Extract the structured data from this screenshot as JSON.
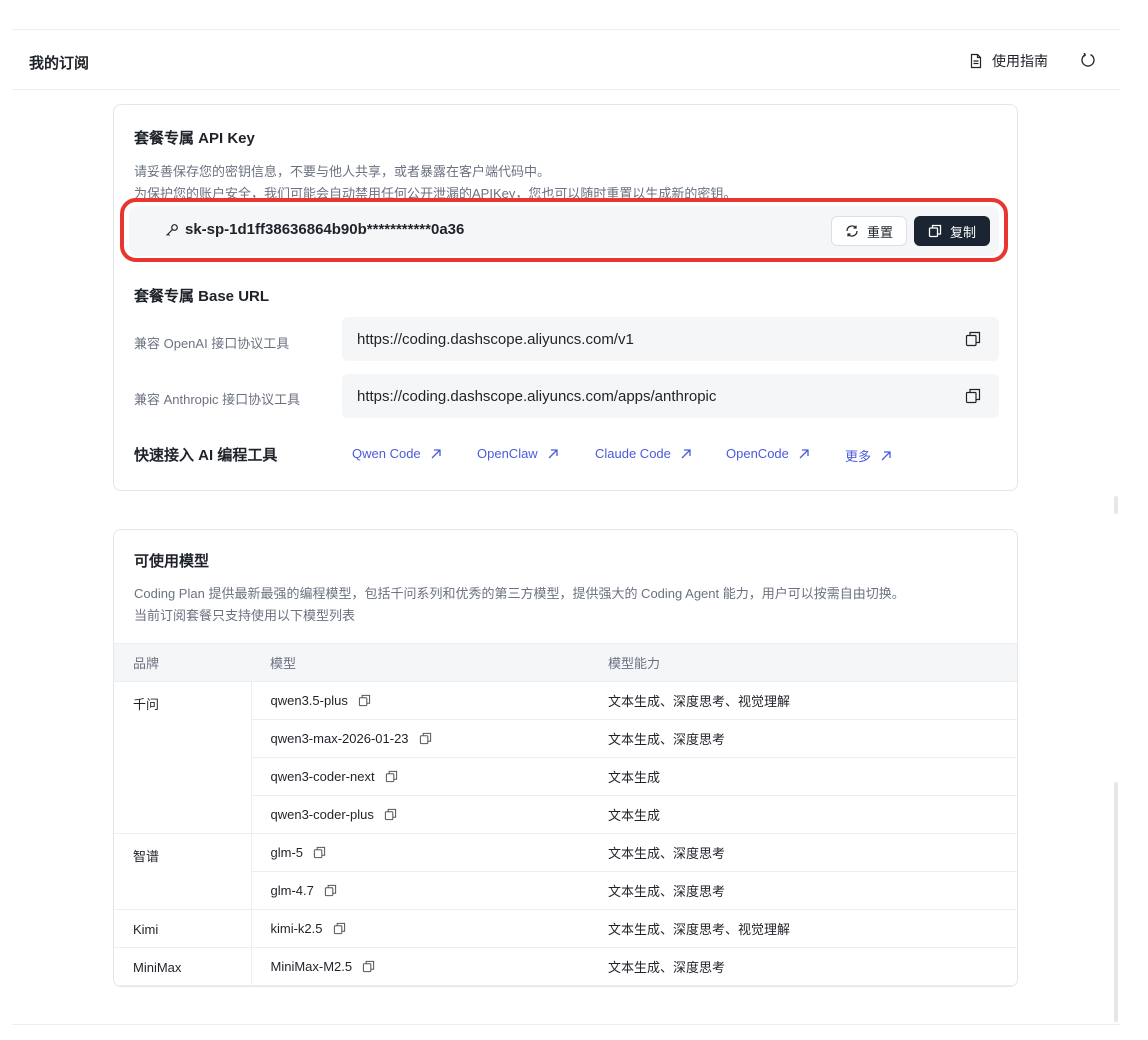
{
  "header": {
    "title": "我的订阅",
    "guide_label": "使用指南"
  },
  "api_key": {
    "title": "套餐专属 API Key",
    "desc_line1": "请妥善保存您的密钥信息，不要与他人共享，或者暴露在客户端代码中。",
    "desc_line2": "为保护您的账户安全，我们可能会自动禁用任何公开泄漏的APIKey，您也可以随时重置以生成新的密钥。",
    "key": "sk-sp-1d1ff38636864b90b***********0a36",
    "reset_label": "重置",
    "copy_label": "复制",
    "highlight_color": "#e8352f"
  },
  "base_url": {
    "title": "套餐专属 Base URL",
    "openai_label": "兼容 OpenAI 接口协议工具",
    "openai_url": "https://coding.dashscope.aliyuncs.com/v1",
    "anthropic_label": "兼容 Anthropic 接口协议工具",
    "anthropic_url": "https://coding.dashscope.aliyuncs.com/apps/anthropic"
  },
  "quick": {
    "title": "快速接入 AI 编程工具",
    "links": [
      "Qwen Code",
      "OpenClaw",
      "Claude Code",
      "OpenCode",
      "更多"
    ],
    "link_color": "#4b5bdc"
  },
  "models": {
    "title": "可使用模型",
    "desc_line1": "Coding Plan 提供最新最强的编程模型，包括千问系列和优秀的第三方模型，提供强大的 Coding Agent 能力，用户可以按需自由切换。",
    "desc_line2": "当前订阅套餐只支持使用以下模型列表",
    "columns": [
      "品牌",
      "模型",
      "模型能力"
    ],
    "groups": [
      {
        "brand": "千问",
        "rows": [
          {
            "model": "qwen3.5-plus",
            "ability": "文本生成、深度思考、视觉理解"
          },
          {
            "model": "qwen3-max-2026-01-23",
            "ability": "文本生成、深度思考"
          },
          {
            "model": "qwen3-coder-next",
            "ability": "文本生成"
          },
          {
            "model": "qwen3-coder-plus",
            "ability": "文本生成"
          }
        ]
      },
      {
        "brand": "智谱",
        "rows": [
          {
            "model": "glm-5",
            "ability": "文本生成、深度思考"
          },
          {
            "model": "glm-4.7",
            "ability": "文本生成、深度思考"
          }
        ]
      },
      {
        "brand": "Kimi",
        "rows": [
          {
            "model": "kimi-k2.5",
            "ability": "文本生成、深度思考、视觉理解"
          }
        ]
      },
      {
        "brand": "MiniMax",
        "rows": [
          {
            "model": "MiniMax-M2.5",
            "ability": "文本生成、深度思考"
          }
        ]
      }
    ]
  }
}
